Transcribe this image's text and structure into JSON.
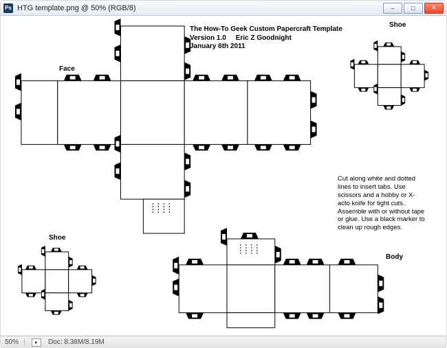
{
  "window": {
    "app_glyph": "Ps",
    "title": "HTG template.png @ 50% (RGB/8)"
  },
  "buttons": {
    "minimize_glyph": "–",
    "maximize_glyph": "□",
    "close_glyph": "✕"
  },
  "document": {
    "title_line1": "The How-To Geek Custom Papercraft Template",
    "title_line2": "Version 1.0",
    "title_author": "Eric Z Goodnight",
    "title_line3": "January 6th 2011",
    "instructions": "Cut along white and dotted lines to insert tabs. Use scissors and a hobby or X-acto knife for tight cuts. Assemble with or without tape or glue. Use a black marker to clean up rough edges.",
    "labels": {
      "face": "Face",
      "shoe_top": "Shoe",
      "shoe_left": "Shoe",
      "body": "Body"
    }
  },
  "status": {
    "zoom": "50%",
    "doc_info": "Doc: 8.38M/8.19M",
    "nav_glyph": "▸"
  }
}
